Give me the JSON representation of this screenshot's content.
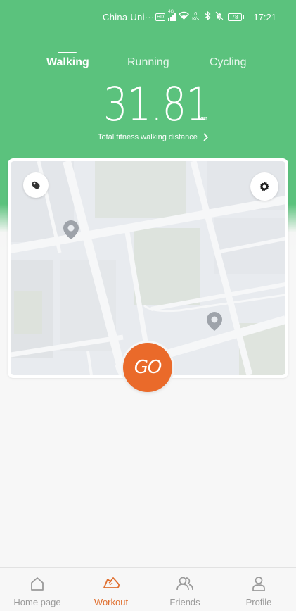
{
  "status_bar": {
    "carrier": "China Uni···",
    "network_tag": "HD",
    "signal_tag": "4G",
    "speed_value": "0",
    "speed_unit": "K/s",
    "battery": "78",
    "time": "17:21",
    "icons": [
      "hd-icon",
      "signal-icon",
      "wifi-icon",
      "bluetooth-icon",
      "mute-bell-icon",
      "battery-icon"
    ]
  },
  "tabs": [
    {
      "label": "Walking",
      "active": true
    },
    {
      "label": "Running",
      "active": false
    },
    {
      "label": "Cycling",
      "active": false
    }
  ],
  "distance": {
    "value": "31.81",
    "unit": "km",
    "label": "Total fitness walking distance"
  },
  "map": {
    "left_button_icon": "shoe-tag-icon",
    "right_button_icon": "gear-icon",
    "pins": [
      "location-pin-icon",
      "location-pin-icon"
    ]
  },
  "go_button": {
    "label": "GO"
  },
  "bottom_nav": [
    {
      "label": "Home page",
      "icon": "home-icon",
      "active": false
    },
    {
      "label": "Workout",
      "icon": "running-shoe-icon",
      "active": true
    },
    {
      "label": "Friends",
      "icon": "friends-icon",
      "active": false
    },
    {
      "label": "Profile",
      "icon": "profile-icon",
      "active": false
    }
  ],
  "colors": {
    "header_green": "#5bc27d",
    "accent_orange": "#ea6a2a",
    "nav_active": "#e07030",
    "nav_inactive": "#9a9a9a"
  }
}
